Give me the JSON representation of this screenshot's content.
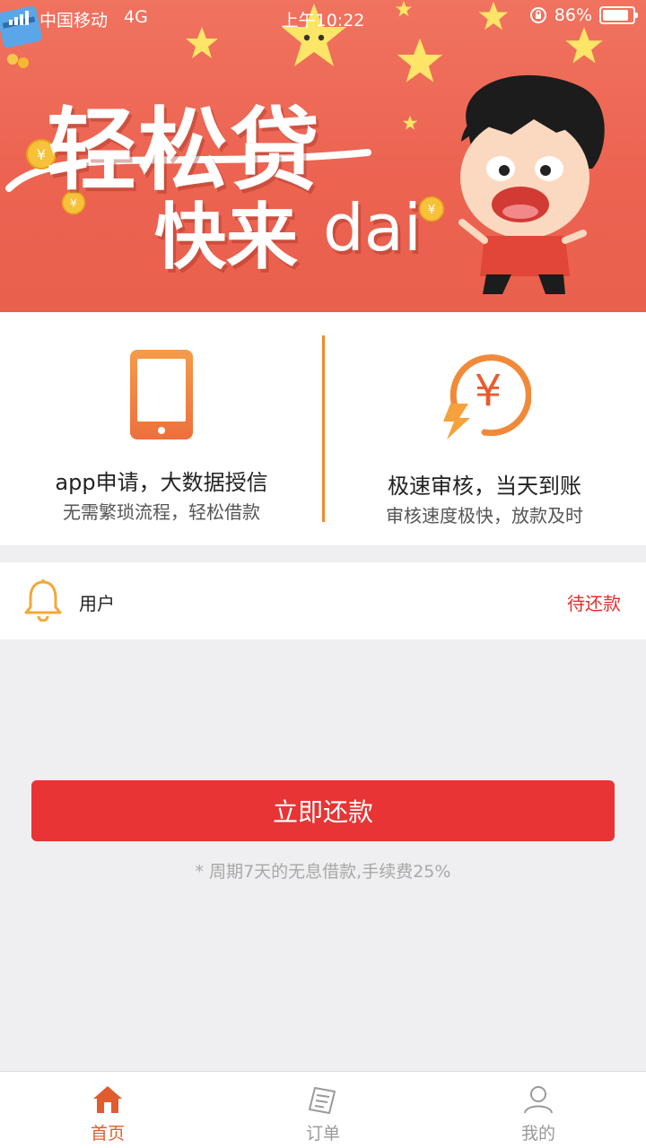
{
  "status_bar": {
    "carrier": "中国移动",
    "network": "4G",
    "time": "上午10:22",
    "battery": "86%"
  },
  "banner": {
    "title": "轻松贷",
    "subtitle": "快来",
    "subtitle_latin": "dai",
    "bg_color": "#ec6451"
  },
  "features": [
    {
      "icon": "phone-icon",
      "title": "app申请，大数据授信",
      "subtitle": "无需繁琐流程，轻松借款"
    },
    {
      "icon": "fast-yuan-icon",
      "title": "极速审核，当天到账",
      "subtitle": "审核速度极快，放款及时"
    }
  ],
  "notice": {
    "icon": "bell-icon",
    "user_label": "用户",
    "status": "待还款",
    "status_color": "#e0302c"
  },
  "repay": {
    "button_label": "立即还款",
    "note": "*  周期7天的无息借款,手续费25%",
    "button_color": "#e83434"
  },
  "tabbar": {
    "tabs": [
      {
        "label": "首页",
        "icon": "home-icon",
        "active": true
      },
      {
        "label": "订单",
        "icon": "order-icon",
        "active": false
      },
      {
        "label": "我的",
        "icon": "user-icon",
        "active": false
      }
    ],
    "active_color": "#e05b2e"
  }
}
